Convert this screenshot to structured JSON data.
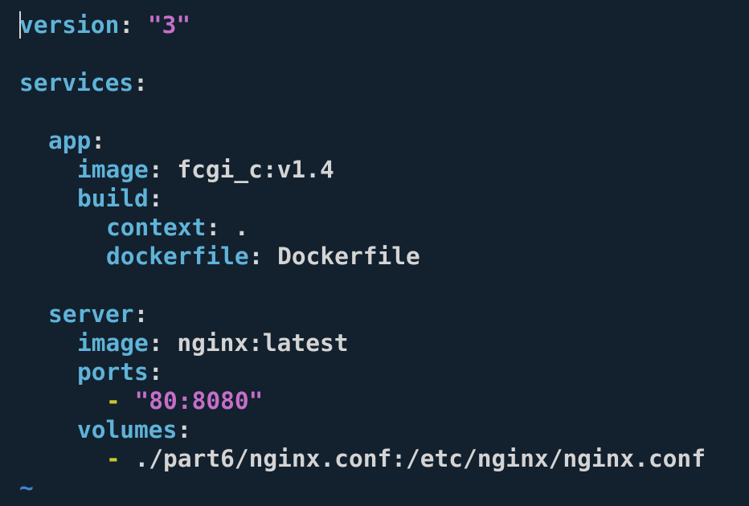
{
  "lines": {
    "l1": {
      "key": "version",
      "colon": ":",
      "value": "\"3\""
    },
    "l2": {
      "key": "services",
      "colon": ":"
    },
    "l3": {
      "key": "app",
      "colon": ":"
    },
    "l4": {
      "key": "image",
      "colon": ":",
      "value": "fcgi_c:v1.4"
    },
    "l5": {
      "key": "build",
      "colon": ":"
    },
    "l6": {
      "key": "context",
      "colon": ":",
      "value": "."
    },
    "l7": {
      "key": "dockerfile",
      "colon": ":",
      "value": "Dockerfile"
    },
    "l8": {
      "key": "server",
      "colon": ":"
    },
    "l9": {
      "key": "image",
      "colon": ":",
      "value": "nginx:latest"
    },
    "l10": {
      "key": "ports",
      "colon": ":"
    },
    "l11": {
      "dash": "-",
      "value": "\"80:8080\""
    },
    "l12": {
      "key": "volumes",
      "colon": ":"
    },
    "l13": {
      "dash": "-",
      "value": "./part6/nginx.conf:/etc/nginx/nginx.conf"
    }
  },
  "empty_line_marker": "~",
  "colors": {
    "background": "#13202e",
    "key": "#5fb3d8",
    "string": "#c56fc9",
    "plain": "#d4d4d4",
    "list_dash": "#c9c830",
    "tilde": "#3f86d0"
  }
}
